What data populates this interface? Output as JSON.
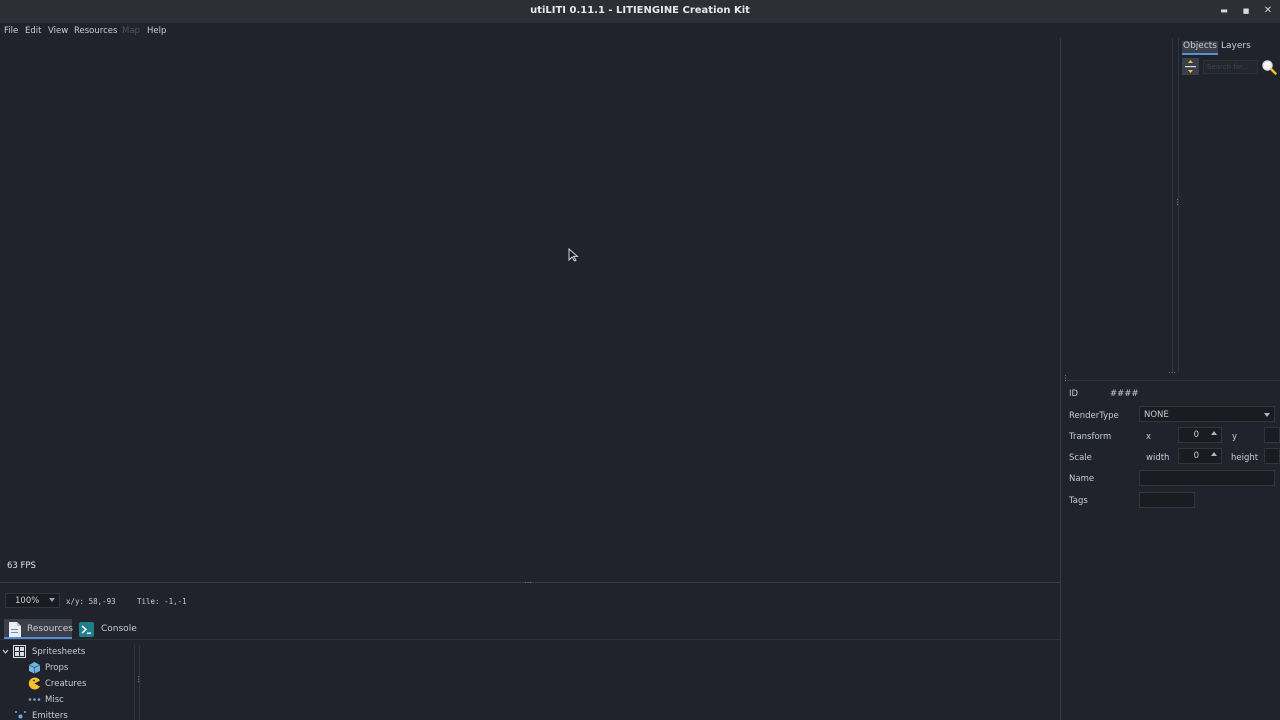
{
  "window": {
    "title": "utiLITI 0.11.1 - LITIENGINE Creation Kit",
    "minimize_glyph": "▬",
    "maximize_glyph": "■",
    "close_glyph": "✕"
  },
  "menu": {
    "file": "File",
    "edit": "Edit",
    "view": "View",
    "resources": "Resources",
    "map": "Map",
    "help": "Help"
  },
  "canvas": {
    "fps": "63 FPS"
  },
  "statusbar": {
    "zoom": "100%",
    "xy": "x/y: 58,-93",
    "tile": "Tile: -1,-1"
  },
  "bottom_tabs": {
    "resources": "Resources",
    "console": "Console"
  },
  "tree": {
    "spritesheets": "Spritesheets",
    "props": "Props",
    "creatures": "Creatures",
    "misc": "Misc",
    "emitters": "Emitters"
  },
  "right_tabs": {
    "objects": "Objects",
    "layers": "Layers"
  },
  "search": {
    "placeholder": "Search for..."
  },
  "properties": {
    "id_label": "ID",
    "id_value": "####",
    "rendertype_label": "RenderType",
    "rendertype_value": "NONE",
    "transform_label": "Transform",
    "x_label": "x",
    "x_value": "0",
    "y_label": "y",
    "scale_label": "Scale",
    "width_label": "width",
    "width_value": "0",
    "height_label": "height",
    "name_label": "Name",
    "name_value": "",
    "tags_label": "Tags",
    "tags_value": ""
  },
  "colors": {
    "background": "#20232b",
    "titlebar": "#2c2f36",
    "accent": "#5a8fd8",
    "text": "#c8ccd3"
  }
}
